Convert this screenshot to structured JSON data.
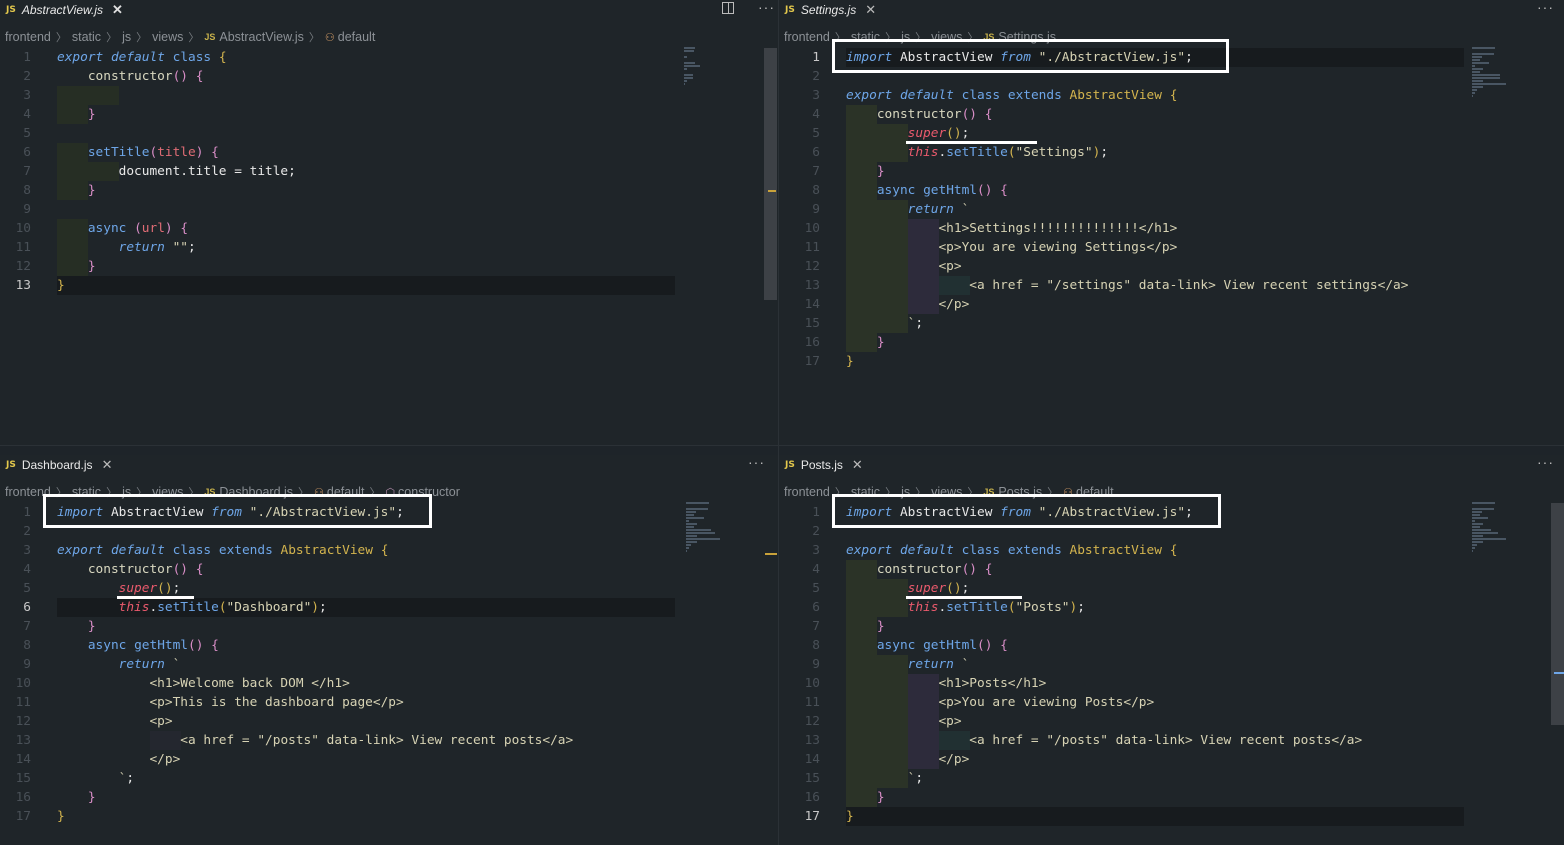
{
  "panes": [
    {
      "id": "abstract",
      "tab": {
        "label": "AbstractView.js",
        "icon": "js-file-icon",
        "italic": true,
        "close": "✕"
      },
      "breadcrumb": [
        "frontend",
        "static",
        "js",
        "views",
        "AbstractView.js",
        "default"
      ],
      "active_line": 13,
      "lines": [
        "1",
        "2",
        "3",
        "4",
        "5",
        "6",
        "7",
        "8",
        "9",
        "10",
        "11",
        "12",
        "13"
      ]
    },
    {
      "id": "settings",
      "tab": {
        "label": "Settings.js",
        "icon": "js-file-icon",
        "italic": true,
        "close": "✕"
      },
      "breadcrumb": [
        "frontend",
        "static",
        "js",
        "views",
        "Settings.js"
      ],
      "active_line": 1,
      "lines": [
        "1",
        "2",
        "3",
        "4",
        "5",
        "6",
        "7",
        "8",
        "9",
        "10",
        "11",
        "12",
        "13",
        "14",
        "15",
        "16",
        "17"
      ],
      "settings_h1": "<h1>Settings!!!!!!!!!!!!!!</h1>",
      "title_arg": "\"Settings\""
    },
    {
      "id": "dashboard",
      "tab": {
        "label": "Dashboard.js",
        "icon": "js-file-icon",
        "italic": false,
        "close": "✕"
      },
      "breadcrumb": [
        "frontend",
        "static",
        "js",
        "views",
        "Dashboard.js",
        "default",
        "constructor"
      ],
      "active_line": 6,
      "lines": [
        "1",
        "2",
        "3",
        "4",
        "5",
        "6",
        "7",
        "8",
        "9",
        "10",
        "11",
        "12",
        "13",
        "14",
        "15",
        "16",
        "17"
      ],
      "title_arg": "\"Dashboard\""
    },
    {
      "id": "posts",
      "tab": {
        "label": "Posts.js",
        "icon": "js-file-icon",
        "italic": false,
        "close": "✕"
      },
      "breadcrumb": [
        "frontend",
        "static",
        "js",
        "views",
        "Posts.js",
        "default"
      ],
      "active_line": 17,
      "lines": [
        "1",
        "2",
        "3",
        "4",
        "5",
        "6",
        "7",
        "8",
        "9",
        "10",
        "11",
        "12",
        "13",
        "14",
        "15",
        "16",
        "17"
      ],
      "title_arg": "\"Posts\""
    }
  ],
  "more_actions": "···",
  "code": {
    "import_stmt": "import AbstractView from \"./AbstractView.js\";",
    "export_default": "export default class",
    "extends_abstract": "extends AbstractView",
    "constructor": "constructor() {",
    "super_call": "super();",
    "settitle": "this.setTitle(",
    "async_gethtml": "async getHtml() {",
    "return_tick": "return `",
    "close_tick": "`;",
    "dashboard_h1": "<h1>Welcome back DOM </h1>",
    "dashboard_p": "<p>This is the dashboard page</p>",
    "settings_p": "<p>You are viewing Settings</p>",
    "posts_h1": "<h1>Posts</h1>",
    "posts_p": "<p>You are viewing Posts</p>",
    "p_open": "<p>",
    "p_close": "</p>",
    "link_settings": "<a href = \"/settings\" data-link> View recent settings</a>",
    "link_posts": "<a href = \"/posts\" data-link> View recent posts</a>"
  }
}
